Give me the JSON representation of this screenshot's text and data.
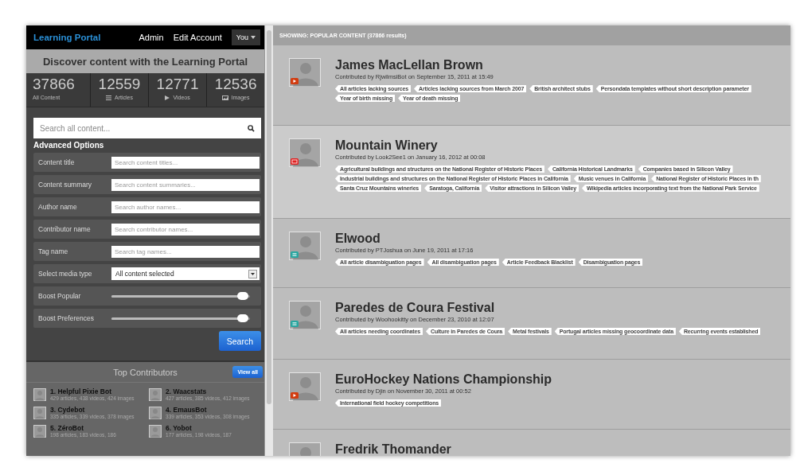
{
  "header": {
    "brand": "Learning Portal",
    "links": [
      "Admin",
      "Edit Account"
    ],
    "user_menu": "You"
  },
  "banner": "Discover content with the Learning Portal",
  "stats": [
    {
      "value": "37866",
      "label": "All Content",
      "kind": "all"
    },
    {
      "value": "12559",
      "label": "Articles",
      "kind": "article"
    },
    {
      "value": "12771",
      "label": "Videos",
      "kind": "video"
    },
    {
      "value": "12536",
      "label": "Images",
      "kind": "image"
    }
  ],
  "search": {
    "placeholder": "Search all content..."
  },
  "advanced": {
    "title": "Advanced Options",
    "rows": [
      {
        "kind": "text",
        "label": "Content title",
        "placeholder": "Search content titles..."
      },
      {
        "kind": "text",
        "label": "Content summary",
        "placeholder": "Search content summaries..."
      },
      {
        "kind": "text",
        "label": "Author name",
        "placeholder": "Search author names..."
      },
      {
        "kind": "text",
        "label": "Contributor name",
        "placeholder": "Search contributor names..."
      },
      {
        "kind": "text",
        "label": "Tag name",
        "placeholder": "Search tag names..."
      },
      {
        "kind": "select",
        "label": "Select media type",
        "value": "All content selected"
      },
      {
        "kind": "slider",
        "label": "Boost Popular",
        "level": 0.95
      },
      {
        "kind": "slider",
        "label": "Boost Preferences",
        "level": 0.95
      }
    ],
    "button": "Search"
  },
  "contributors": {
    "title": "Top Contributors",
    "button": "View all",
    "items": [
      {
        "name": "1. Helpful Pixie Bot",
        "stats": "429 articles, 438 videos, 424 images"
      },
      {
        "name": "2. Waacstats",
        "stats": "427 articles, 385 videos, 412 images"
      },
      {
        "name": "3. Cydebot",
        "stats": "335 articles, 339 videos, 378 images"
      },
      {
        "name": "4. EmausBot",
        "stats": "339 articles, 353 videos, 308 images"
      },
      {
        "name": "5. ZéroBot",
        "stats": "198 articles, 183 videos, 186"
      },
      {
        "name": "6. Yobot",
        "stats": "177 articles, 198 videos, 187"
      }
    ]
  },
  "results": {
    "heading": "SHOWING: POPULAR CONTENT (37866 results)",
    "items": [
      {
        "title": "James MacLellan Brown",
        "byline": "Contributed by RjwilmsiBot on September 15, 2011 at 15:49",
        "kind": "video",
        "highlighted": false,
        "tag_rows": [
          [
            "All articles lacking sources",
            "Articles lacking sources from March 2007",
            "British architect stubs",
            "Persondata templates without short description parameter"
          ],
          [
            "Year of birth missing",
            "Year of death missing"
          ]
        ]
      },
      {
        "title": "Mountain Winery",
        "byline": "Contributed by Look2See1 on January 16, 2012 at 00:08",
        "kind": "image",
        "highlighted": true,
        "tag_rows": [
          [
            "Agricultural buildings and structures on the National Register of Historic Places",
            "California Historical Landmarks",
            "Companies based in Silicon Valley"
          ],
          [
            "Industrial buildings and structures on the National Register of Historic Places in California",
            "Music venues in California",
            "National Register of Historic Places in th"
          ],
          [
            "Santa Cruz Mountains wineries",
            "Saratoga, California",
            "Visitor attractions in Silicon Valley",
            "Wikipedia articles incorporating text from the National Park Service"
          ]
        ]
      },
      {
        "title": "Elwood",
        "byline": "Contributed by PTJoshua on June 19, 2011 at 17:16",
        "kind": "article",
        "highlighted": false,
        "tag_rows": [
          [
            "All article disambiguation pages",
            "All disambiguation pages",
            "Article Feedback Blacklist",
            "Disambiguation pages"
          ]
        ]
      },
      {
        "title": "Paredes de Coura Festival",
        "byline": "Contributed by Woohookitty on December 23, 2010 at 12:07",
        "kind": "article",
        "highlighted": false,
        "tag_rows": [
          [
            "All articles needing coordinates",
            "Culture in Paredes de Coura",
            "Metal festivals",
            "Portugal articles missing geocoordinate data",
            "Recurring events established"
          ]
        ]
      },
      {
        "title": "EuroHockey Nations Championship",
        "byline": "Contributed by Djin on November 30, 2011 at 00:52",
        "kind": "video",
        "highlighted": false,
        "tag_rows": [
          [
            "International field hockey competitions"
          ]
        ]
      },
      {
        "title": "Fredrik Thomander",
        "kind": "none",
        "highlighted": false
      }
    ]
  }
}
